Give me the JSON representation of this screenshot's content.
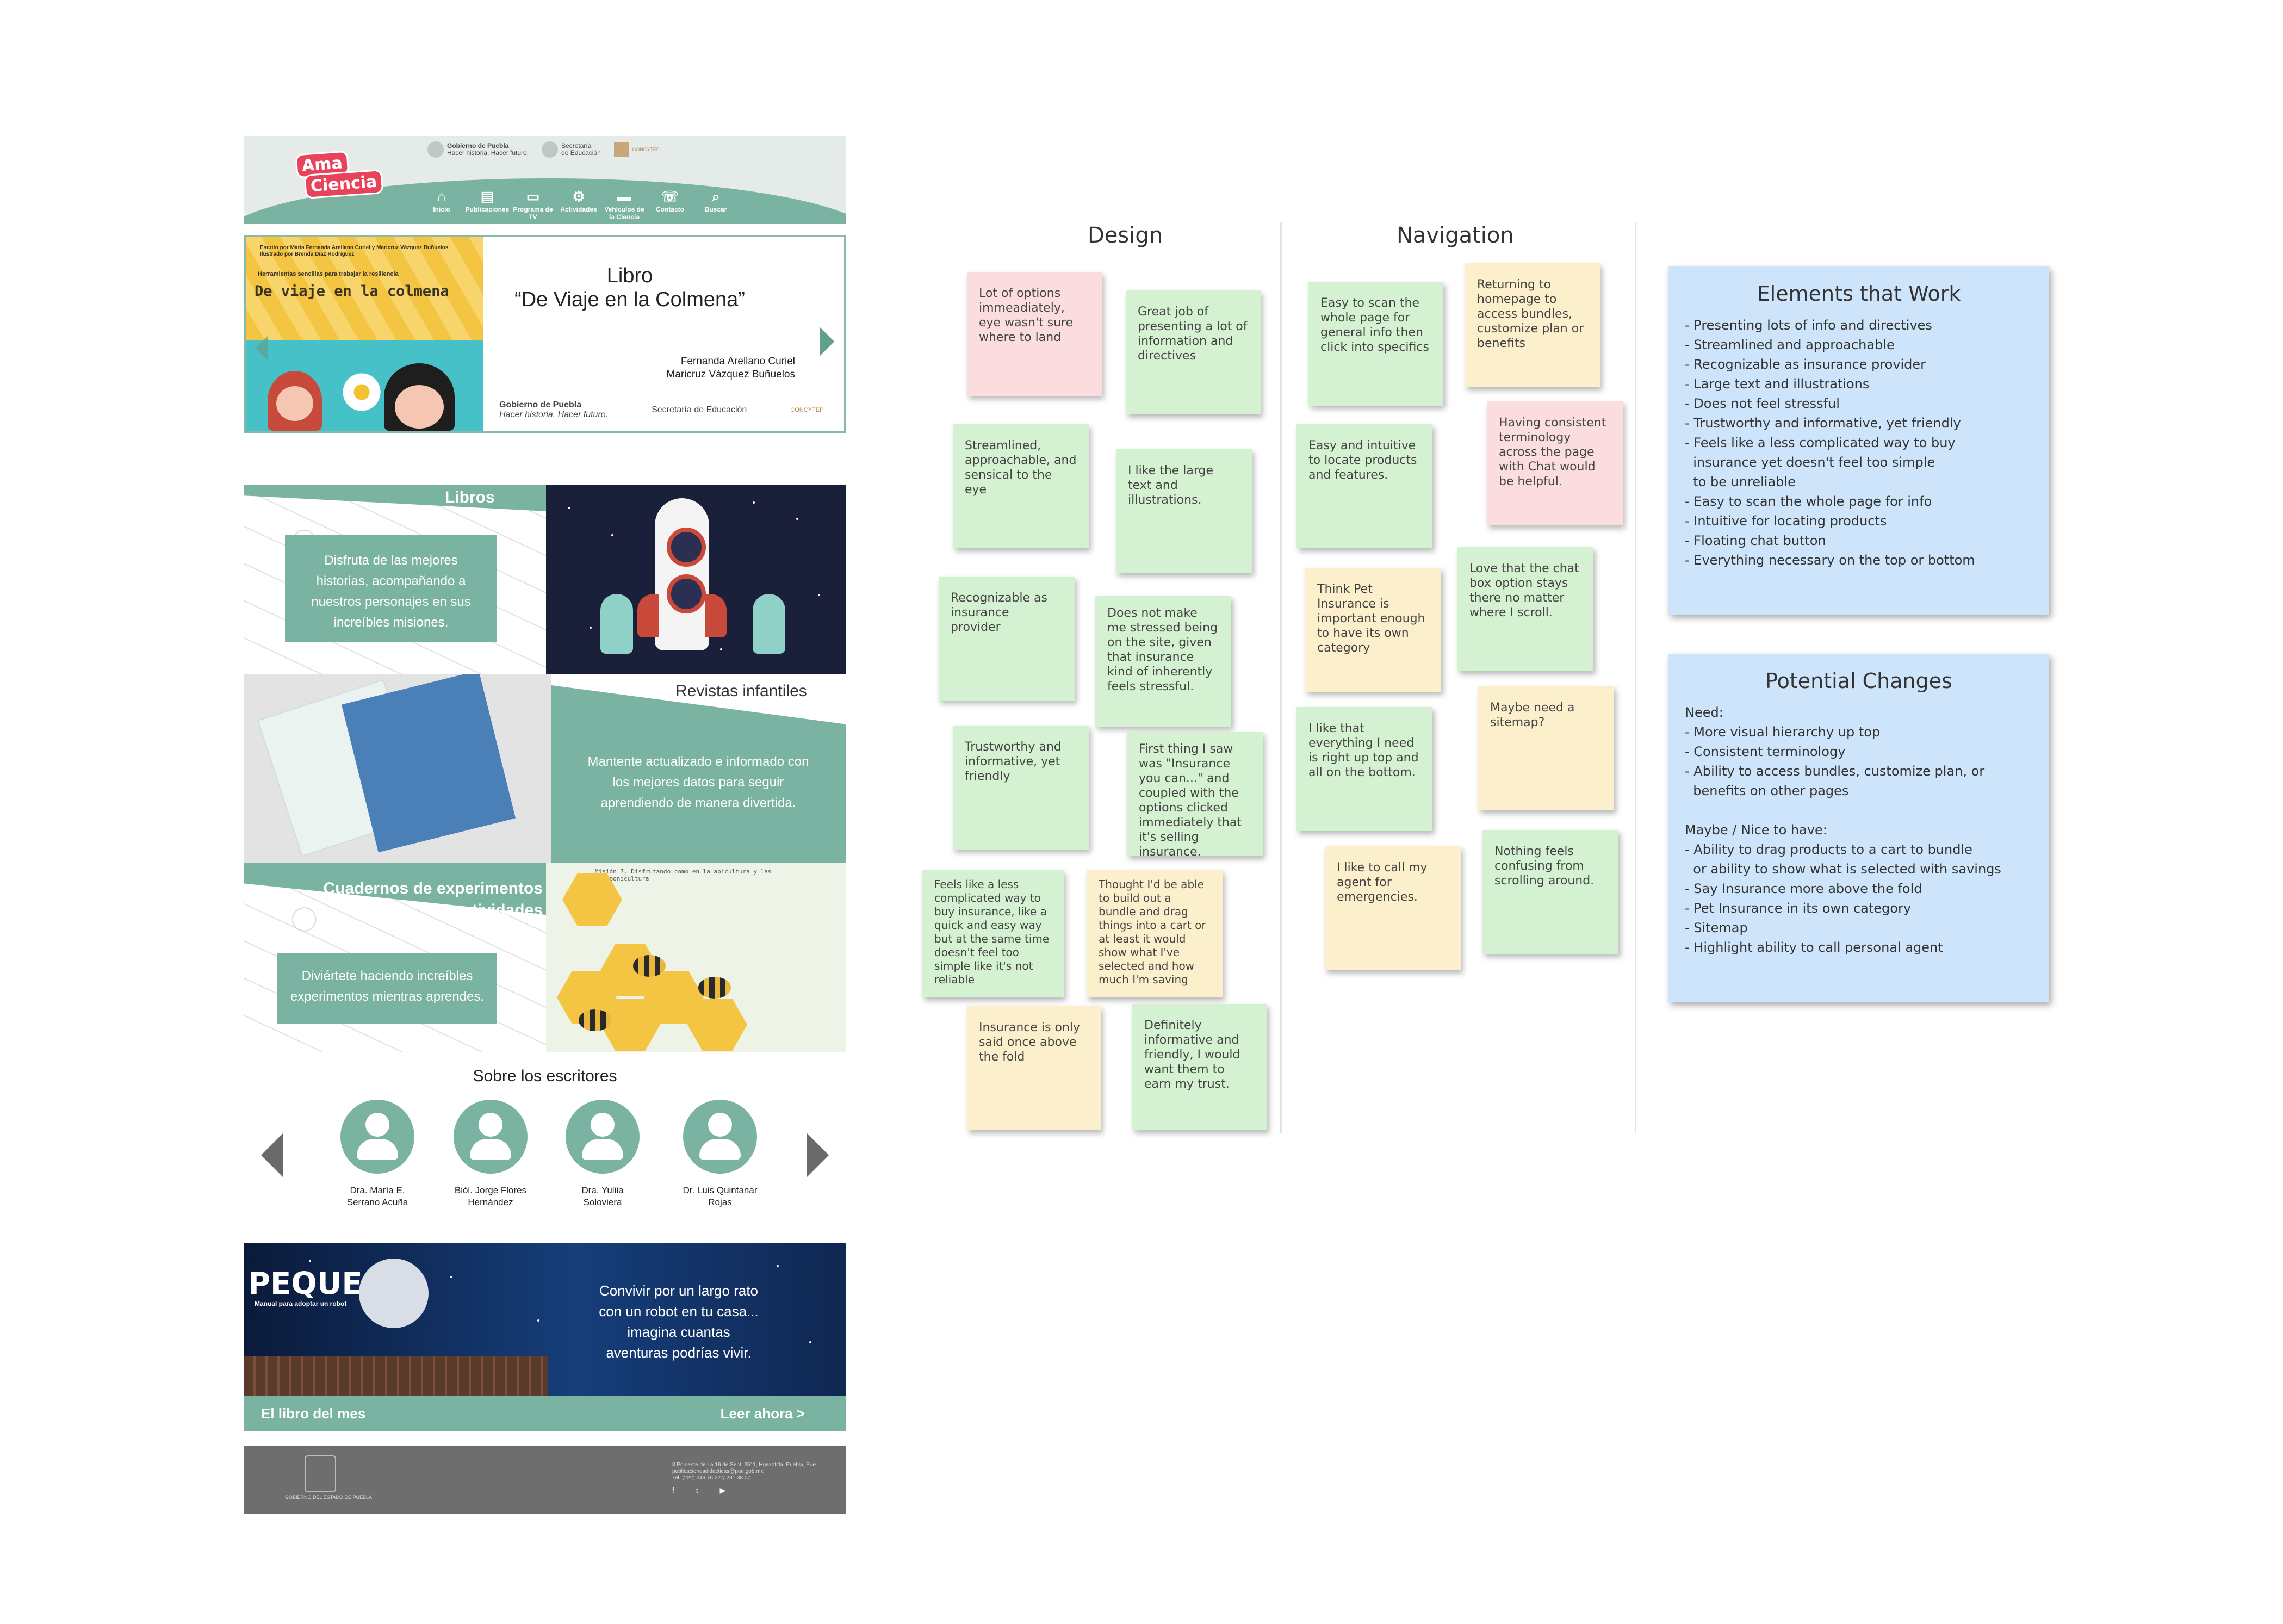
{
  "mockup": {
    "header": {
      "logo_line1": "Ama",
      "logo_line2": "Ciencia",
      "gov_logo1_title": "Gobierno de Puebla",
      "gov_logo1_sub": "Hacer historia. Hacer futuro.",
      "gov_logo2_title": "Secretaría",
      "gov_logo2_sub": "de Educación",
      "gov_logo3_title": "CONCYTEP",
      "nav": [
        {
          "label": "Inicio",
          "icon": "home-icon",
          "glyph": "⌂"
        },
        {
          "label": "Publicaciones",
          "icon": "book-icon",
          "glyph": "▤"
        },
        {
          "label": "Programa de TV",
          "icon": "tv-icon",
          "glyph": "▭"
        },
        {
          "label": "Actividades",
          "icon": "gamepad-icon",
          "glyph": "⚙"
        },
        {
          "label": "Vehículos de la Ciencia",
          "icon": "truck-icon",
          "glyph": "▬"
        },
        {
          "label": "Contacto",
          "icon": "phone-icon",
          "glyph": "☏"
        },
        {
          "label": "Buscar",
          "icon": "search-icon",
          "glyph": "⌕"
        }
      ]
    },
    "hero": {
      "cover_credit1": "Escrito por María Fernanda Arellano Curiel y Maricruz Vázquez Buñuelos",
      "cover_credit2": "Ilustrado por Brenda Díaz Rodríguez",
      "cover_subtitle": "Herramientas sencillas para trabajar la resiliencia",
      "cover_title": "De viaje en la colmena",
      "label": "Libro",
      "title": "“De Viaje en la Colmena”",
      "author1": "Fernanda Arellano Curiel",
      "author2": "Maricruz Vázquez Buñuelos",
      "footer_logo1": "Gobierno de Puebla",
      "footer_logo1_sub": "Hacer historia. Hacer futuro.",
      "footer_logo2": "Secretaría de Educación",
      "footer_logo3": "CONCYTEP"
    },
    "libros": {
      "title": "Libros",
      "text": "Disfruta de las mejores historias, acompañando a nuestros personajes en sus increíbles misiones."
    },
    "revistas": {
      "title": "Revistas infantiles",
      "text": "Mantente actualizado e informado con los mejores datos para seguir aprendiendo de manera divertida."
    },
    "cuadernos": {
      "title_line1": "Cuadernos de experimentos",
      "title_line2": "y actividades",
      "text": "Diviértete haciendo increíbles experimentos mientras aprendes.",
      "image_heading": "Misión 7. Disfrutando como en la apicultura y las meliponicultura"
    },
    "writers": {
      "title": "Sobre los  escritores",
      "people": [
        {
          "line1": "Dra. María E.",
          "line2": "Serrano Acuña"
        },
        {
          "line1": "Biól. Jorge Flores",
          "line2": "Hernández"
        },
        {
          "line1": "Dra. Yuliia",
          "line2": "Soloviera"
        },
        {
          "line1": "Dr. Luis Quintanar",
          "line2": "Rojas"
        }
      ]
    },
    "peque": {
      "title": "PEQUE",
      "subtitle": "Manual para adoptar un robot",
      "text": "Convivir por un largo rato con un robot en tu casa... imagina cuantas aventuras podrías vivir.",
      "bar_left": "El libro del mes",
      "bar_right": "Leer ahora >"
    },
    "footer": {
      "gov": "GOBIERNO DEL ESTADO DE PUEBLA",
      "address1": "8 Poniente de La 16 de Sept. #511, Huexotitla, Puebla, Pue.",
      "address2": "publicacionesdidacticas@pue.gob.mx",
      "address3": "Tel. (222) 249 76 22 y 231 38 07",
      "social": "f t ▶"
    }
  },
  "board": {
    "design_title": "Design",
    "navigation_title": "Navigation",
    "design_notes": [
      {
        "text": "Lot of options immeadiately, eye wasn't sure where to land",
        "color": "p"
      },
      {
        "text": "Great job of presenting a lot of information and directives",
        "color": "g"
      },
      {
        "text": "Streamlined, approachable, and sensical to the eye",
        "color": "g"
      },
      {
        "text": "I like the large text and illustrations.",
        "color": "g"
      },
      {
        "text": "Recognizable as insurance provider",
        "color": "g"
      },
      {
        "text": "Does not make me stressed being on the site, given that insurance kind of inherently feels stressful.",
        "color": "g"
      },
      {
        "text": "Trustworthy and informative, yet friendly",
        "color": "g"
      },
      {
        "text": "First thing I saw was \"Insurance you can...\" and coupled with the options clicked immediately that it's selling insurance.",
        "color": "g"
      },
      {
        "text": "Feels like a less complicated way to buy insurance, like a quick and easy way but at the same time doesn't feel too simple like it's not reliable",
        "color": "g"
      },
      {
        "text": "Thought I'd be able to build out a bundle and drag things into a cart or at least it would show what I've selected and how much I'm saving",
        "color": "y"
      },
      {
        "text": "Insurance is only said once above the fold",
        "color": "y"
      },
      {
        "text": "Definitely informative and friendly, I would want them to earn my trust.",
        "color": "g"
      }
    ],
    "navigation_notes": [
      {
        "text": "Easy to scan the whole page for general info then click into specifics",
        "color": "g"
      },
      {
        "text": "Returning to homepage to access bundles, customize plan or benefits",
        "color": "y"
      },
      {
        "text": "Easy and intuitive to locate products and features.",
        "color": "g"
      },
      {
        "text": "Having consistent terminology across the page with Chat would be helpful.",
        "color": "p"
      },
      {
        "text": "Think Pet Insurance is important enough to have its own category",
        "color": "y"
      },
      {
        "text": "Love that the chat box option stays there no matter where I scroll.",
        "color": "g"
      },
      {
        "text": "I like that everything I need is right up top and all on the bottom.",
        "color": "g"
      },
      {
        "text": "Maybe need a sitemap?",
        "color": "y"
      },
      {
        "text": "I like to call my agent for emergencies.",
        "color": "y"
      },
      {
        "text": "Nothing feels confusing from scrolling around.",
        "color": "g"
      }
    ],
    "elements_that_work": {
      "title": "Elements that Work",
      "lines": [
        "- Presenting lots of info and directives",
        "- Streamlined and approachable",
        "- Recognizable as insurance provider",
        "- Large text and illustrations",
        "- Does not feel stressful",
        "- Trustworthy and informative, yet friendly",
        "- Feels like a less complicated way to buy",
        "  insurance yet doesn't feel too simple",
        "  to be unreliable",
        "- Easy to scan the whole page for info",
        "- Intuitive for locating products",
        "- Floating chat button",
        "- Everything necessary on the top or bottom"
      ]
    },
    "potential_changes": {
      "title": "Potential Changes",
      "lines": [
        "Need:",
        "- More visual hierarchy up top",
        "- Consistent terminology",
        "- Ability to access bundles, customize plan, or",
        "  benefits on other pages",
        "",
        "Maybe / Nice to have:",
        "- Ability to drag products to a cart to bundle",
        "  or ability to show what is selected with savings",
        "- Say Insurance more above the fold",
        "- Pet Insurance in its own category",
        "- Sitemap",
        "- Highlight ability to call personal agent"
      ]
    }
  }
}
